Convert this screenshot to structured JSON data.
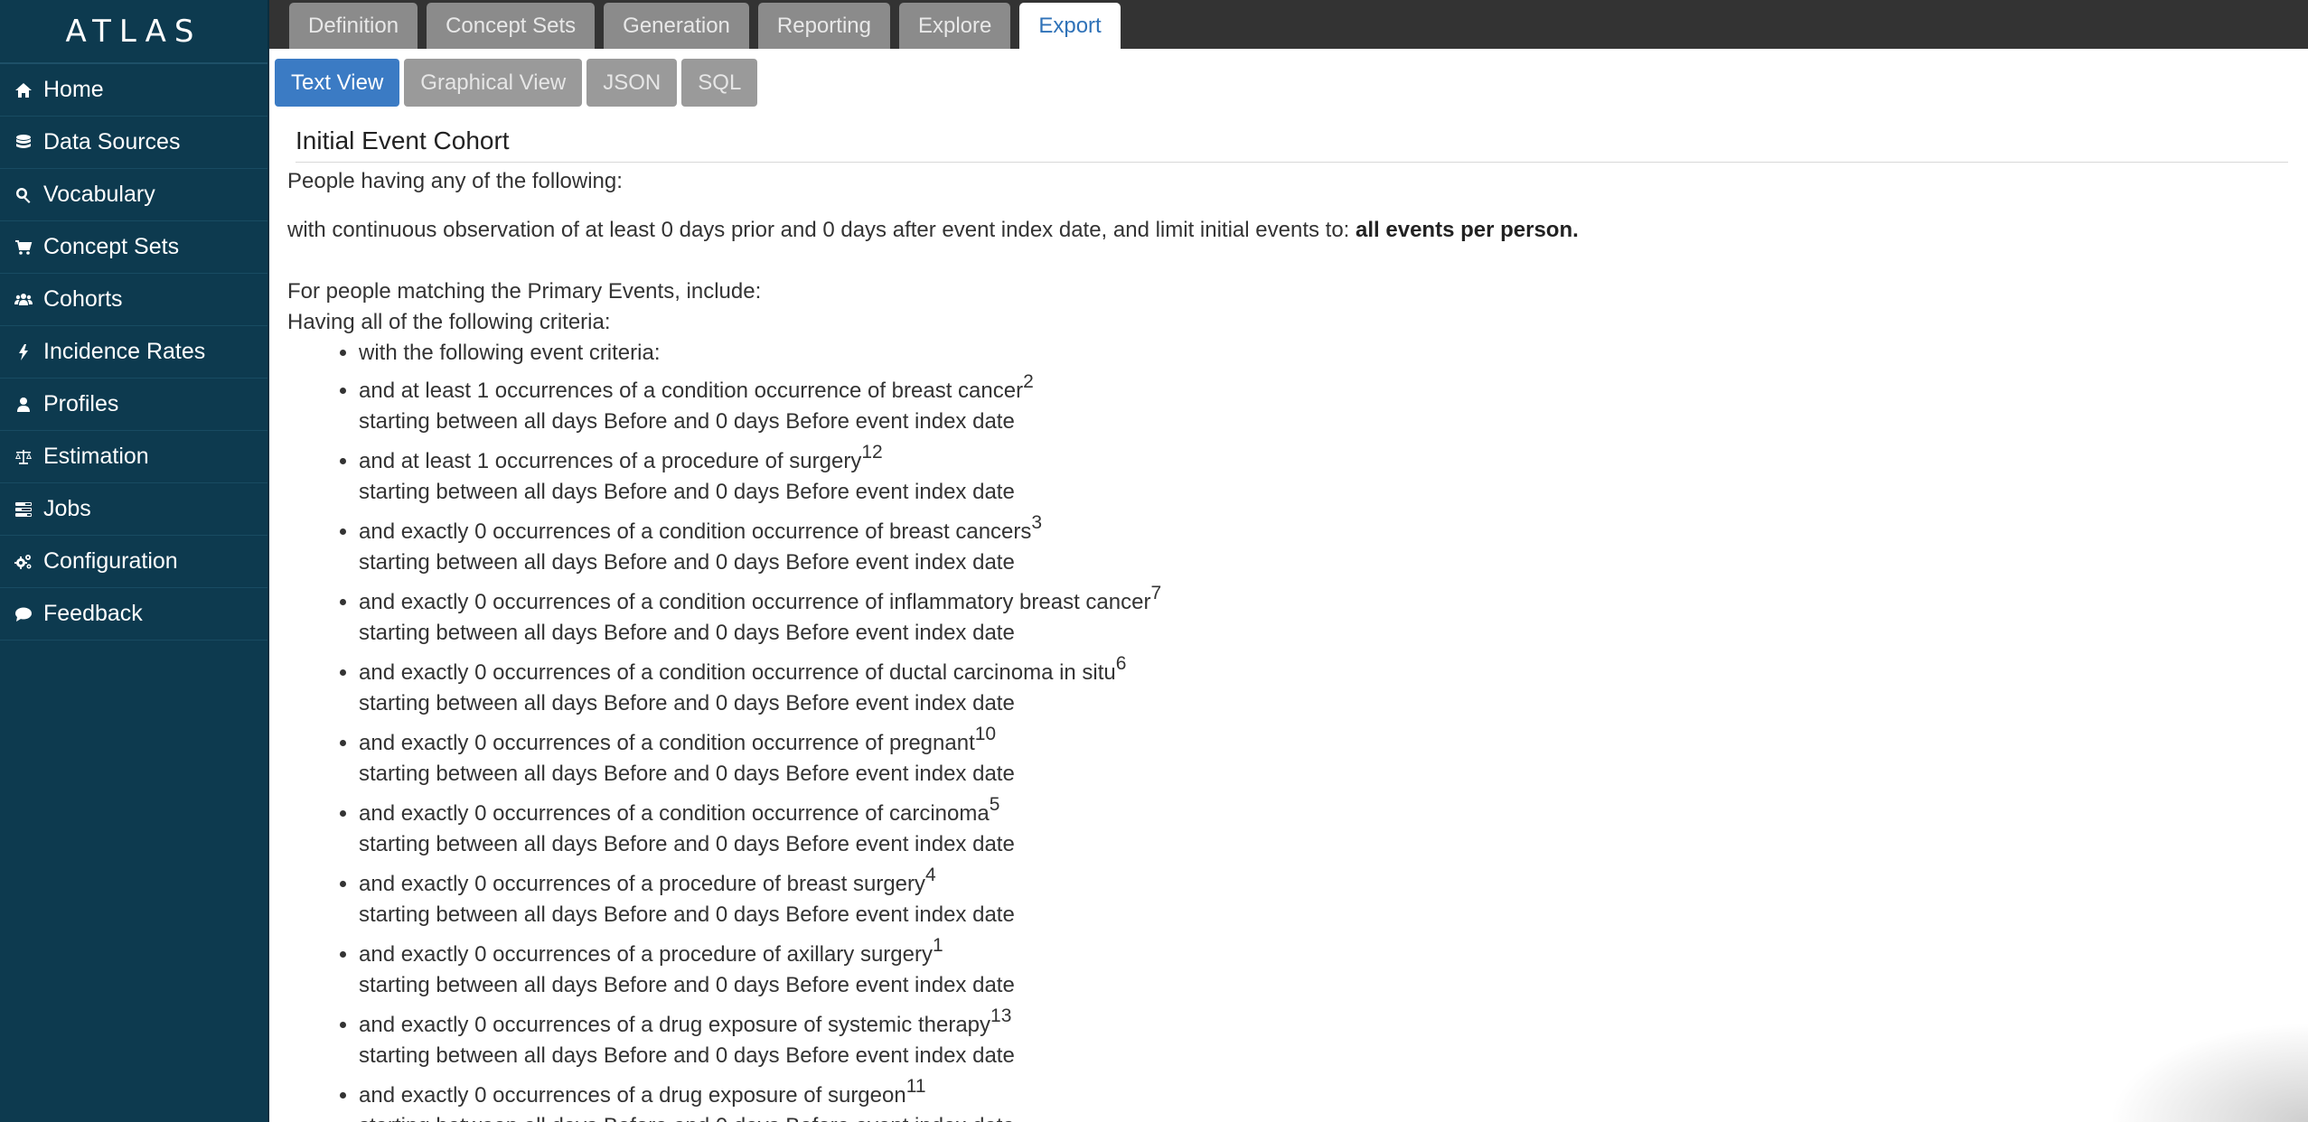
{
  "brand": "ATLAS",
  "sidebar": {
    "items": [
      {
        "label": "Home",
        "icon": "home-icon"
      },
      {
        "label": "Data Sources",
        "icon": "database-icon"
      },
      {
        "label": "Vocabulary",
        "icon": "search-icon"
      },
      {
        "label": "Concept Sets",
        "icon": "shopping-cart-icon"
      },
      {
        "label": "Cohorts",
        "icon": "users-icon"
      },
      {
        "label": "Incidence Rates",
        "icon": "bolt-icon"
      },
      {
        "label": "Profiles",
        "icon": "user-icon"
      },
      {
        "label": "Estimation",
        "icon": "balance-scale-icon"
      },
      {
        "label": "Jobs",
        "icon": "tasks-icon"
      },
      {
        "label": "Configuration",
        "icon": "cogs-icon"
      },
      {
        "label": "Feedback",
        "icon": "comment-icon"
      }
    ]
  },
  "tabs": [
    {
      "label": "Definition",
      "active": false
    },
    {
      "label": "Concept Sets",
      "active": false
    },
    {
      "label": "Generation",
      "active": false
    },
    {
      "label": "Reporting",
      "active": false
    },
    {
      "label": "Explore",
      "active": false
    },
    {
      "label": "Export",
      "active": true
    }
  ],
  "subtabs": [
    {
      "label": "Text View",
      "active": true
    },
    {
      "label": "Graphical View",
      "active": false
    },
    {
      "label": "JSON",
      "active": false
    },
    {
      "label": "SQL",
      "active": false
    }
  ],
  "content": {
    "section_title": "Initial Event Cohort",
    "people_having": "People having any of the following:",
    "observation_text": "with continuous observation of at least 0 days prior and 0 days after event index date, and limit initial events to: ",
    "observation_bold": "all events per person.",
    "include_intro": "For people matching the Primary Events, include:",
    "having_all": "Having all of the following criteria:",
    "criteria_header": "with the following event criteria:",
    "timing": "starting between all days Before and 0 days Before event index date",
    "criteria": [
      {
        "text": "and at least 1 occurrences of a condition occurrence of breast cancer",
        "ref": "2"
      },
      {
        "text": "and at least 1 occurrences of a procedure of surgery",
        "ref": "12"
      },
      {
        "text": "and exactly 0 occurrences of a condition occurrence of breast cancers",
        "ref": "3"
      },
      {
        "text": "and exactly 0 occurrences of a condition occurrence of inflammatory breast cancer",
        "ref": "7"
      },
      {
        "text": "and exactly 0 occurrences of a condition occurrence of ductal carcinoma in situ",
        "ref": "6"
      },
      {
        "text": "and exactly 0 occurrences of a condition occurrence of pregnant",
        "ref": "10"
      },
      {
        "text": "and exactly 0 occurrences of a condition occurrence of carcinoma",
        "ref": "5"
      },
      {
        "text": "and exactly 0 occurrences of a procedure of breast surgery",
        "ref": "4"
      },
      {
        "text": "and exactly 0 occurrences of a procedure of axillary surgery",
        "ref": "1"
      },
      {
        "text": "and exactly 0 occurrences of a drug exposure of systemic therapy",
        "ref": "13"
      },
      {
        "text": "and exactly 0 occurrences of a drug exposure of surgeon",
        "ref": "11"
      }
    ]
  }
}
